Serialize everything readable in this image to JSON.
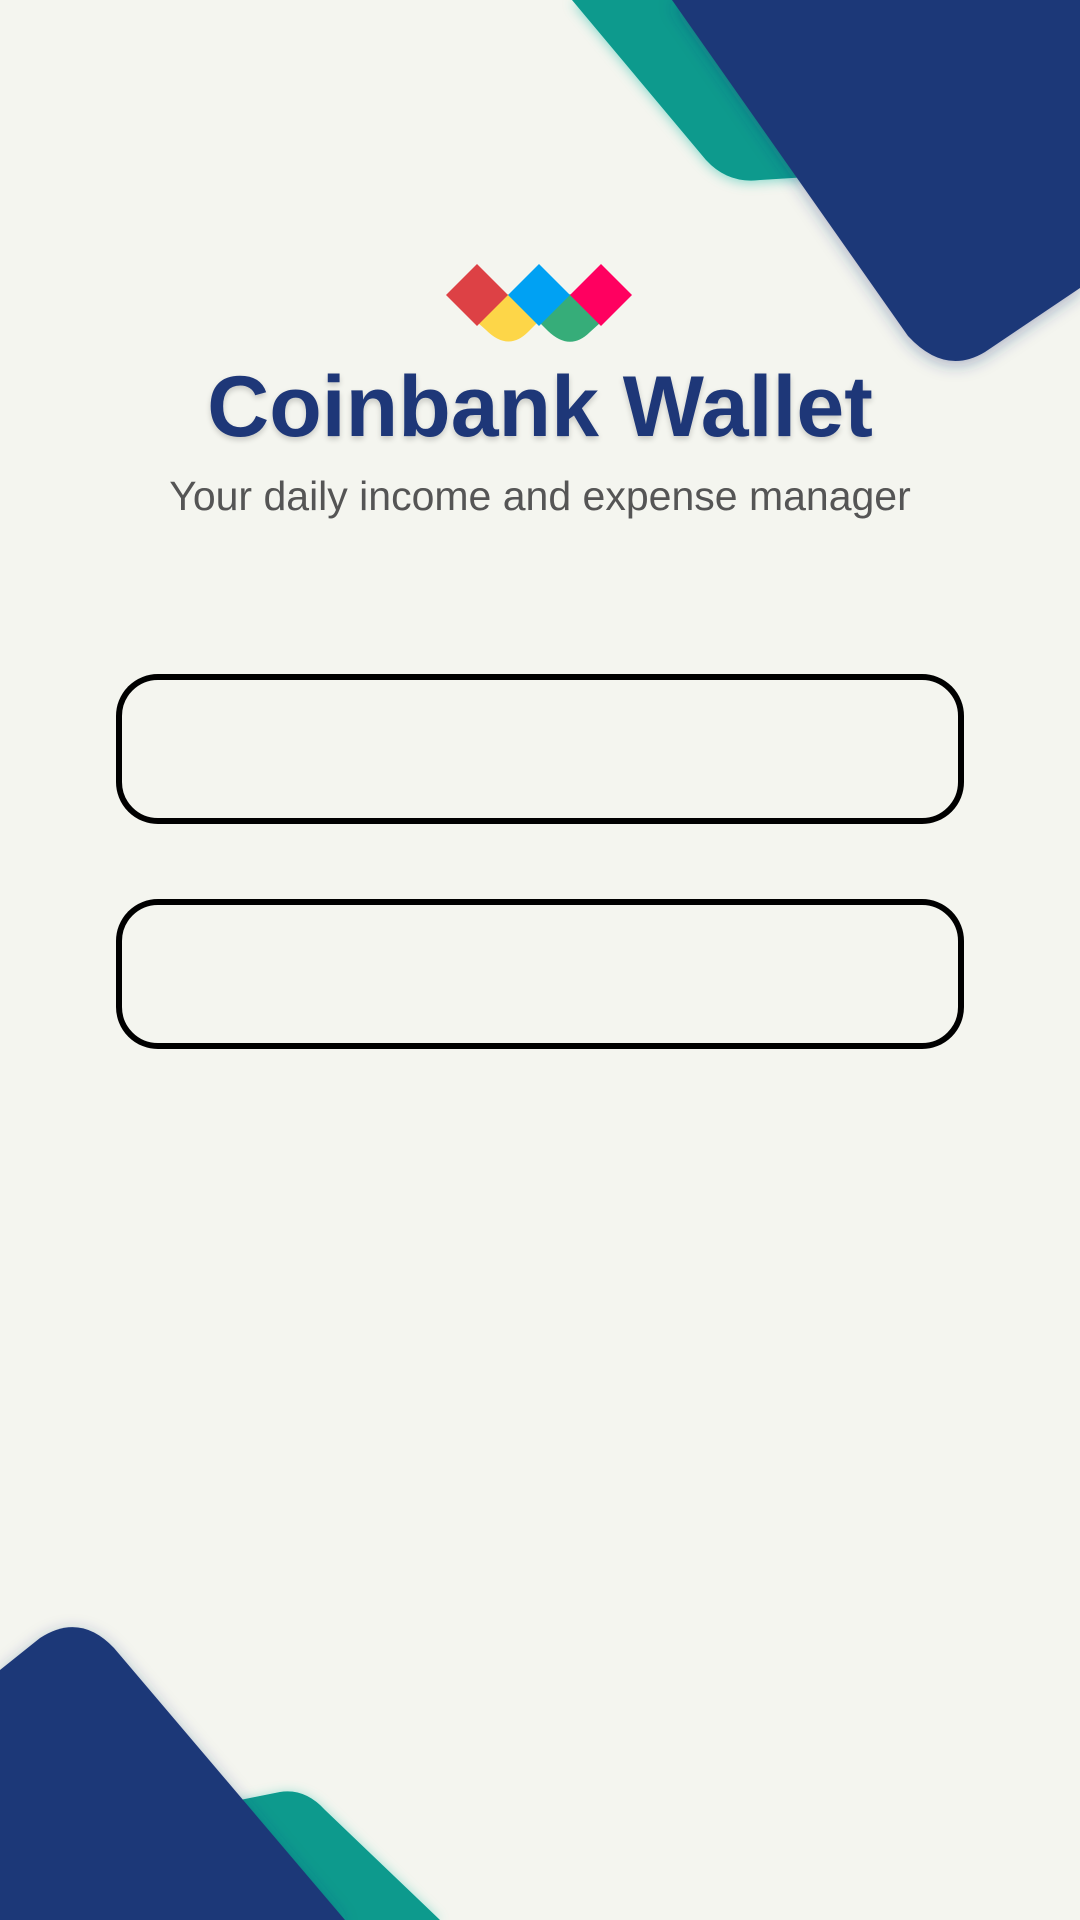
{
  "app": {
    "title": "Coinbank Wallet",
    "subtitle": "Your daily income and expense manager"
  },
  "logo": {
    "icon": "coinbank-diamond-logo-icon",
    "tile_colors": [
      "#dd4145",
      "#00a1f3",
      "#ff0060",
      "#fdd648",
      "#36ad79"
    ]
  },
  "form": {
    "first_field": {
      "value": "",
      "placeholder": ""
    },
    "second_field": {
      "value": "",
      "placeholder": ""
    }
  },
  "colors": {
    "background": "#f4f5ef",
    "primary_navy": "#1e3778",
    "accent_teal": "#079a8d",
    "field_border": "#000000",
    "subtitle_text": "#555555"
  }
}
